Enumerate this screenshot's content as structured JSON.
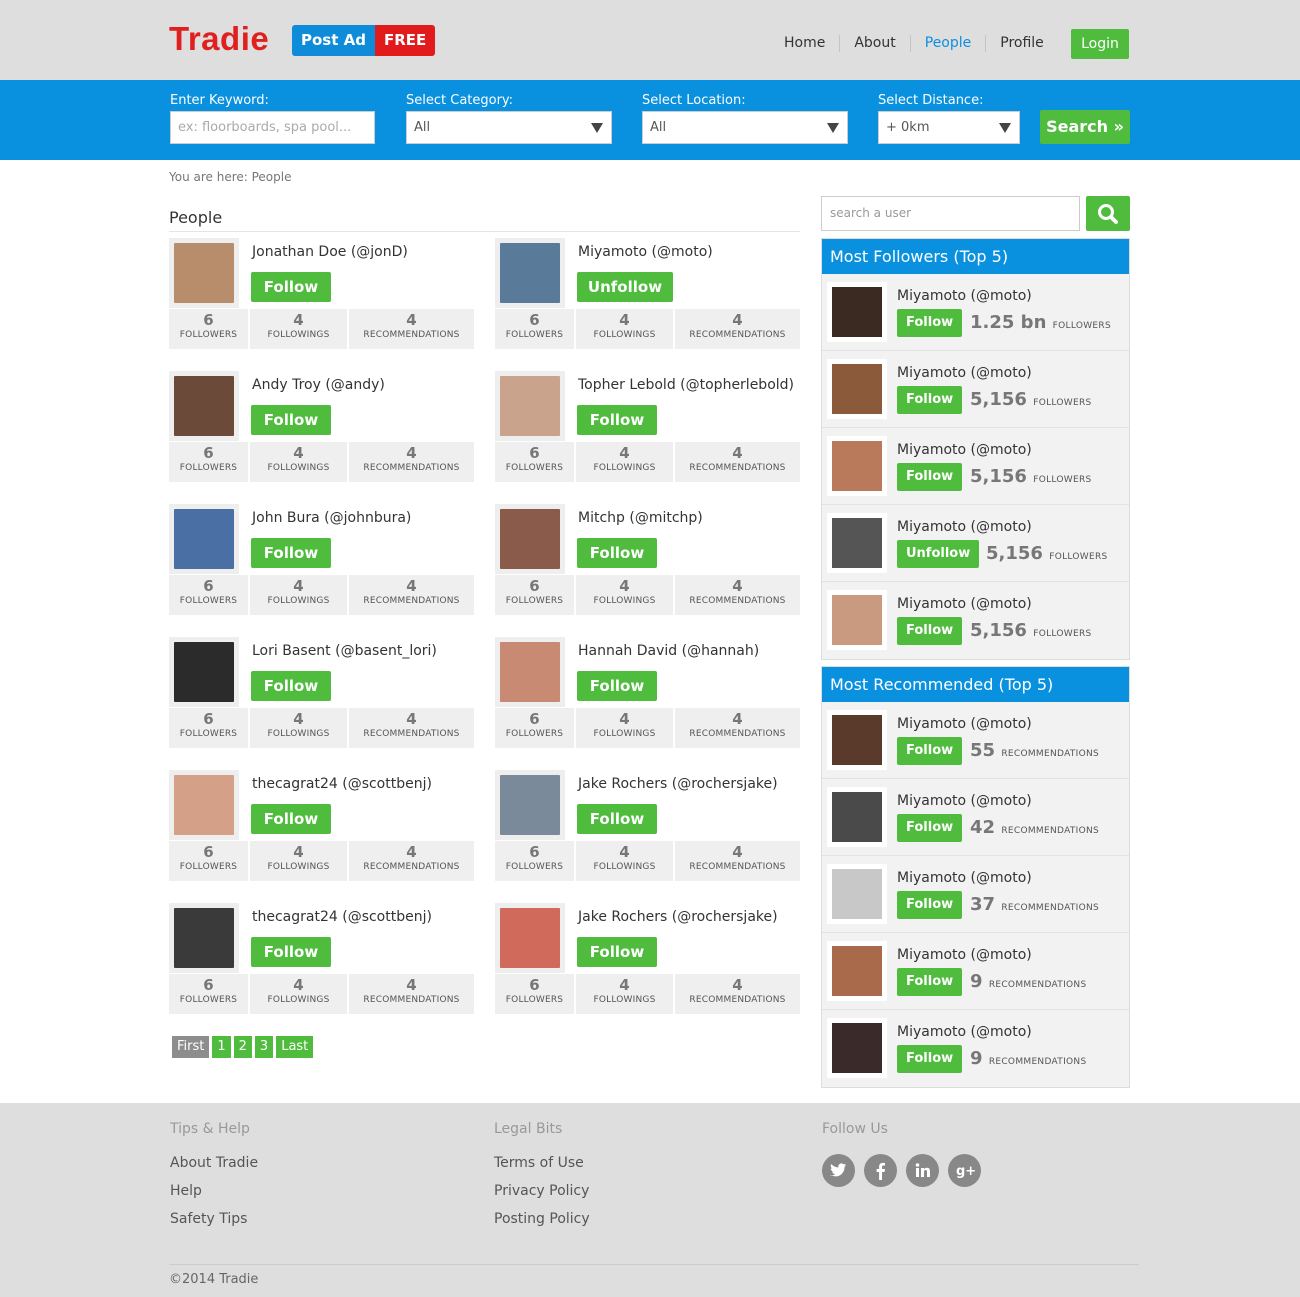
{
  "header": {
    "logo": "Tradie",
    "post_ad": "Post Ad",
    "post_ad_free": "FREE",
    "nav": [
      "Home",
      "About",
      "People",
      "Profile"
    ],
    "login": "Login"
  },
  "search": {
    "keyword_label": "Enter Keyword:",
    "keyword_placeholder": "ex: floorboards, spa pool...",
    "category_label": "Select Category:",
    "category_value": "All",
    "location_label": "Select Location:",
    "location_value": "All",
    "distance_label": "Select Distance:",
    "distance_value": "+ 0km",
    "button": "Search »"
  },
  "breadcrumb": "You are here:  People",
  "people": {
    "title": "People",
    "stat_labels": [
      "FOLLOWERS",
      "FOLLOWINGS",
      "RECOMMENDATIONS"
    ],
    "cards": [
      {
        "name": "Jonathan Doe (@jonD)",
        "button": "Follow",
        "followers": "6",
        "followings": "4",
        "recommendations": "4"
      },
      {
        "name": "Miyamoto (@moto)",
        "button": "Unfollow",
        "followers": "6",
        "followings": "4",
        "recommendations": "4"
      },
      {
        "name": "Andy Troy (@andy)",
        "button": "Follow",
        "followers": "6",
        "followings": "4",
        "recommendations": "4"
      },
      {
        "name": "Topher Lebold (@topherlebold)",
        "button": "Follow",
        "followers": "6",
        "followings": "4",
        "recommendations": "4"
      },
      {
        "name": "John Bura (@johnbura)",
        "button": "Follow",
        "followers": "6",
        "followings": "4",
        "recommendations": "4"
      },
      {
        "name": "Mitchp (@mitchp)",
        "button": "Follow",
        "followers": "6",
        "followings": "4",
        "recommendations": "4"
      },
      {
        "name": "Lori Basent (@basent_lori)",
        "button": "Follow",
        "followers": "6",
        "followings": "4",
        "recommendations": "4"
      },
      {
        "name": "Hannah David (@hannah)",
        "button": "Follow",
        "followers": "6",
        "followings": "4",
        "recommendations": "4"
      },
      {
        "name": "thecagrat24  (@scottbenj)",
        "button": "Follow",
        "followers": "6",
        "followings": "4",
        "recommendations": "4"
      },
      {
        "name": "Jake Rochers  (@rochersjake)",
        "button": "Follow",
        "followers": "6",
        "followings": "4",
        "recommendations": "4"
      },
      {
        "name": "thecagrat24  (@scottbenj)",
        "button": "Follow",
        "followers": "6",
        "followings": "4",
        "recommendations": "4"
      },
      {
        "name": "Jake Rochers  (@rochersjake)",
        "button": "Follow",
        "followers": "6",
        "followings": "4",
        "recommendations": "4"
      }
    ]
  },
  "pagination": [
    "First",
    "1",
    "2",
    "3",
    "Last"
  ],
  "sidebar": {
    "search_placeholder": "search a user",
    "followers_title": "Most Followers (Top 5)",
    "followers_unit": "FOLLOWERS",
    "followers": [
      {
        "name": "Miyamoto (@moto)",
        "button": "Follow",
        "count": "1.25 bn"
      },
      {
        "name": "Miyamoto (@moto)",
        "button": "Follow",
        "count": "5,156"
      },
      {
        "name": "Miyamoto (@moto)",
        "button": "Follow",
        "count": "5,156"
      },
      {
        "name": "Miyamoto (@moto)",
        "button": "Unfollow",
        "count": "5,156"
      },
      {
        "name": "Miyamoto (@moto)",
        "button": "Follow",
        "count": "5,156"
      }
    ],
    "recommended_title": "Most Recommended (Top 5)",
    "recommended_unit": "RECOMMENDATIONS",
    "recommended": [
      {
        "name": "Miyamoto (@moto)",
        "button": "Follow",
        "count": "55"
      },
      {
        "name": "Miyamoto (@moto)",
        "button": "Follow",
        "count": "42"
      },
      {
        "name": "Miyamoto (@moto)",
        "button": "Follow",
        "count": "37"
      },
      {
        "name": "Miyamoto (@moto)",
        "button": "Follow",
        "count": "9"
      },
      {
        "name": "Miyamoto (@moto)",
        "button": "Follow",
        "count": "9"
      }
    ]
  },
  "footer": {
    "tips_title": "Tips & Help",
    "tips_links": [
      "About Tradie",
      "Help",
      "Safety Tips"
    ],
    "legal_title": "Legal Bits",
    "legal_links": [
      "Terms of Use",
      "Privacy Policy",
      "Posting Policy"
    ],
    "follow_title": "Follow Us",
    "social_icons": [
      "twitter-icon",
      "facebook-icon",
      "linkedin-icon",
      "google-plus-icon"
    ],
    "copyright": "©2014 Tradie"
  },
  "colors": {
    "brand_red": "#e0201f",
    "brand_blue": "#0991df",
    "action_green": "#4fbc3e"
  }
}
